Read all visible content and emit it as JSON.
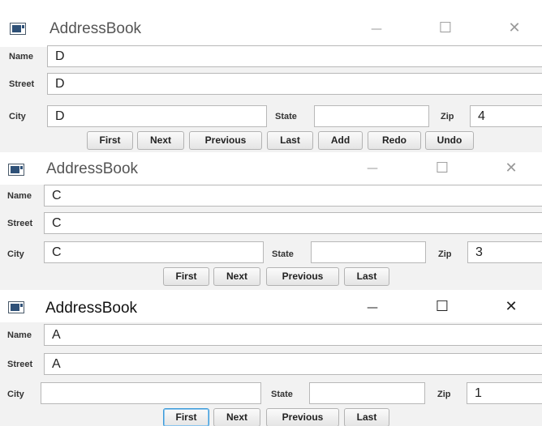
{
  "colors": {
    "window_bg": "#f2f2f2",
    "title_bg": "#ffffff",
    "focus_border": "#3c9ad8"
  },
  "icons": {
    "app": "window-app-icon",
    "minimize": "minimize-icon",
    "maximize": "maximize-icon",
    "close": "close-icon"
  },
  "windows": [
    {
      "title": "AddressBook",
      "minimize": "—",
      "maximize": "☐",
      "close": "✕",
      "labels": {
        "name": "Name",
        "street": "Street",
        "city": "City",
        "state": "State",
        "zip": "Zip"
      },
      "values": {
        "name": "D",
        "street": "D",
        "city": "D",
        "state": "",
        "zip": "4"
      },
      "buttons": [
        "First",
        "Next",
        "Previous",
        "Last",
        "Add",
        "Redo",
        "Undo"
      ]
    },
    {
      "title": "AddressBook",
      "minimize": "—",
      "maximize": "☐",
      "close": "✕",
      "labels": {
        "name": "Name",
        "street": "Street",
        "city": "City",
        "state": "State",
        "zip": "Zip"
      },
      "values": {
        "name": "C",
        "street": "C",
        "city": "C",
        "state": "",
        "zip": "3"
      },
      "buttons": [
        "First",
        "Next",
        "Previous",
        "Last"
      ]
    },
    {
      "title": "AddressBook",
      "minimize": "—",
      "maximize": "☐",
      "close": "✕",
      "labels": {
        "name": "Name",
        "street": "Street",
        "city": "City",
        "state": "State",
        "zip": "Zip"
      },
      "values": {
        "name": "A",
        "street": "A",
        "city": "",
        "state": "",
        "zip": "1"
      },
      "buttons": [
        "First",
        "Next",
        "Previous",
        "Last"
      ]
    }
  ]
}
